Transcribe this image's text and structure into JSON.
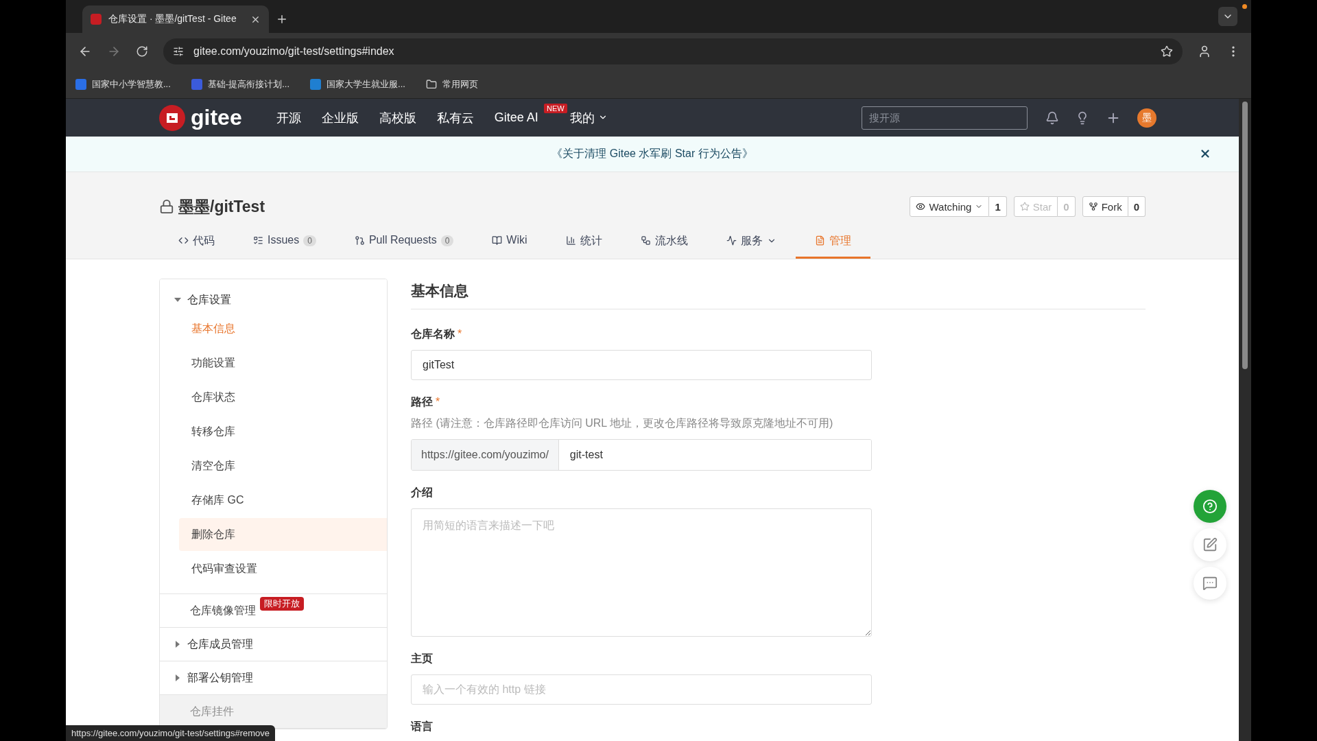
{
  "browser": {
    "tab": {
      "title": "仓库设置 · 墨墨/gitTest - Gitee"
    },
    "url": "gitee.com/youzimo/git-test/settings#index",
    "bookmarks": [
      {
        "label": "国家中小学智慧教...",
        "kind": "app"
      },
      {
        "label": "基础-提高衔接计划...",
        "kind": "app"
      },
      {
        "label": "国家大学生就业服...",
        "kind": "app"
      },
      {
        "label": "常用网页",
        "kind": "folder"
      }
    ],
    "status_url": "https://gitee.com/youzimo/git-test/settings#remove"
  },
  "site": {
    "brand": "gitee",
    "nav": [
      {
        "label": "开源"
      },
      {
        "label": "企业版"
      },
      {
        "label": "高校版"
      },
      {
        "label": "私有云"
      },
      {
        "label": "Gitee AI",
        "badge": "NEW"
      }
    ],
    "mine": "我的",
    "search": {
      "placeholder": "搜开源"
    },
    "avatar": "墨"
  },
  "announcement": "《关于清理 Gitee 水军刷 Star 行为公告》",
  "repo": {
    "title": "墨墨/gitTest",
    "private": true,
    "actions": [
      {
        "kind": "watch",
        "label": "Watching",
        "count": "1",
        "disabled": false
      },
      {
        "kind": "star",
        "label": "Star",
        "count": "0",
        "disabled": true
      },
      {
        "kind": "fork",
        "label": "Fork",
        "count": "0",
        "disabled": false
      }
    ],
    "tabs": [
      {
        "kind": "code",
        "label": "代码",
        "selected": false
      },
      {
        "kind": "issues",
        "label": "Issues",
        "count": "0",
        "selected": false
      },
      {
        "kind": "pr",
        "label": "Pull Requests",
        "count": "0",
        "selected": false
      },
      {
        "kind": "wiki",
        "label": "Wiki",
        "selected": false
      },
      {
        "kind": "stats",
        "label": "统计",
        "selected": false
      },
      {
        "kind": "pipeline",
        "label": "流水线",
        "selected": false
      },
      {
        "kind": "service",
        "label": "服务",
        "selected": false,
        "dropdown": true
      },
      {
        "kind": "manage",
        "label": "管理",
        "selected": true
      }
    ]
  },
  "sidebar": [
    {
      "label": "仓库设置",
      "kind": "group",
      "expanded": true,
      "children": [
        {
          "label": "基本信息",
          "selected": true,
          "hovered": false
        },
        {
          "label": "功能设置",
          "selected": false,
          "hovered": false
        },
        {
          "label": "仓库状态",
          "selected": false,
          "hovered": false
        },
        {
          "label": "转移仓库",
          "selected": false,
          "hovered": false
        },
        {
          "label": "清空仓库",
          "selected": false,
          "hovered": false
        },
        {
          "label": "存储库 GC",
          "selected": false,
          "hovered": false
        },
        {
          "label": "删除仓库",
          "selected": false,
          "hovered": true
        },
        {
          "label": "代码审查设置",
          "selected": false,
          "hovered": false
        }
      ]
    },
    {
      "label": "仓库镜像管理",
      "kind": "link",
      "badge": "限时开放",
      "disabled": false
    },
    {
      "label": "仓库成员管理",
      "kind": "group",
      "expanded": false
    },
    {
      "label": "部署公钥管理",
      "kind": "group",
      "expanded": false
    },
    {
      "label": "仓库挂件",
      "kind": "link",
      "disabled": true
    }
  ],
  "form": {
    "title": "基本信息",
    "fields": [
      {
        "kind": "input",
        "label": "仓库名称",
        "required_mark": "*",
        "value": "gitTest"
      },
      {
        "kind": "prefixed",
        "label": "路径",
        "required_mark": "*",
        "hint": "路径 (请注意：仓库路径即仓库访问 URL 地址，更改仓库路径将导致原克隆地址不可用)",
        "prefix": "https://gitee.com/youzimo/",
        "value": "git-test"
      },
      {
        "kind": "textarea",
        "label": "介绍",
        "placeholder": "用简短的语言来描述一下吧"
      },
      {
        "kind": "input",
        "label": "主页",
        "placeholder": "输入一个有效的 http 链接"
      },
      {
        "kind": "label",
        "label": "语言"
      }
    ]
  },
  "float_buttons": [
    {
      "kind": "help"
    },
    {
      "kind": "edit"
    },
    {
      "kind": "chat"
    }
  ]
}
